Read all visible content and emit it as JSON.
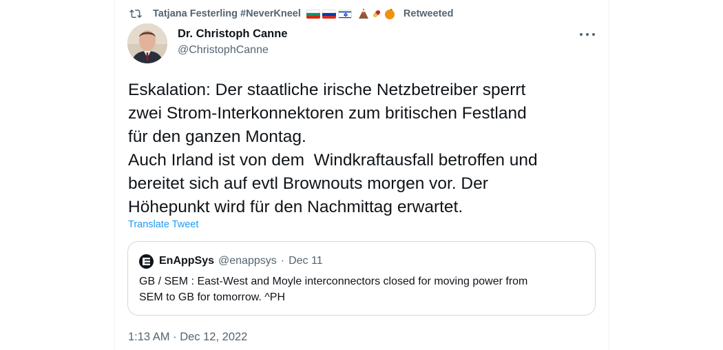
{
  "retweet": {
    "icon": "retweet-icon",
    "user": "Tatjana Festerling #NeverKneel",
    "flags": [
      "bulgaria-flag",
      "russia-flag",
      "israel-flag"
    ],
    "emojis": [
      "volcano-emoji",
      "pill-emoji",
      "orange-emoji"
    ],
    "status": "Retweeted"
  },
  "tweet": {
    "author_name": "Dr. Christoph Canne",
    "author_handle": "@ChristophCanne",
    "lines": [
      "Eskalation: Der staatliche irische Netzbetreiber sperrt",
      "zwei Strom-Interkonnektoren zum britischen Festland",
      "für den ganzen Montag.",
      "Auch Irland ist von dem  Windkraftausfall betroffen und",
      "bereitet sich auf evtl Brownouts morgen vor. Der",
      "Höhepunkt wird für den Nachmittag erwartet."
    ],
    "translate_label": "Translate Tweet",
    "timestamp": "1:13 AM · Dec 12, 2022"
  },
  "quote": {
    "name": "EnAppSys",
    "handle": "@enappsys",
    "separator": "·",
    "date": "Dec 11",
    "lines": [
      "GB / SEM : East-West and Moyle interconnectors closed for moving power from",
      "SEM to GB for tomorrow. ^PH"
    ]
  },
  "colors": {
    "text": "#0f1419",
    "secondary": "#536471",
    "link": "#1d9bf0",
    "border": "#cfd9de"
  }
}
